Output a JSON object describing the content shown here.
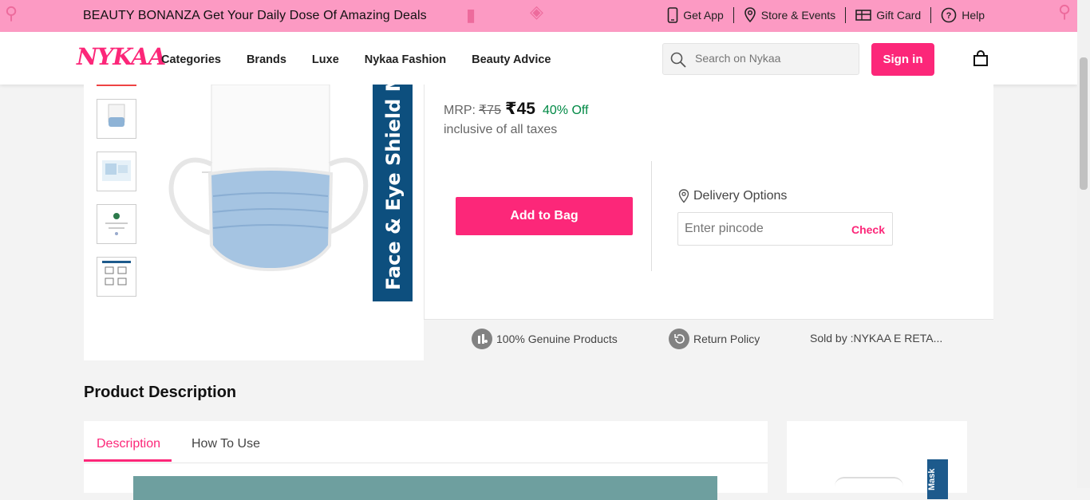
{
  "promo": {
    "text": "BEAUTY BONANZA Get Your Daily Dose Of Amazing Deals",
    "links": [
      {
        "label": "Get App",
        "icon": "phone-icon"
      },
      {
        "label": "Store & Events",
        "icon": "location-pin-icon"
      },
      {
        "label": "Gift Card",
        "icon": "gift-card-icon"
      },
      {
        "label": "Help",
        "icon": "help-icon"
      }
    ]
  },
  "header": {
    "logo": "NYKAA",
    "nav": [
      "Categories",
      "Brands",
      "Luxe",
      "Nykaa Fashion",
      "Beauty Advice"
    ],
    "search_placeholder": "Search on Nykaa",
    "signin_label": "Sign in"
  },
  "product": {
    "image_text": "Face & Eye Shield Ma",
    "mrp_label": "MRP:",
    "mrp": "₹75",
    "price": "₹45",
    "discount": "40% Off",
    "tax_note": "inclusive of all taxes",
    "add_to_bag": "Add to Bag",
    "delivery_title": "Delivery Options",
    "pincode_placeholder": "Enter pincode",
    "check_label": "Check"
  },
  "trust": {
    "genuine": "100% Genuine Products",
    "return": "Return Policy",
    "sold_by": "Sold by :NYKAA E RETA..."
  },
  "description": {
    "title": "Product Description",
    "tabs": [
      "Description",
      "How To Use"
    ],
    "side_text": "Mask"
  },
  "colors": {
    "brand": "#fc2779",
    "promo_bg": "#fc9ac3",
    "discount": "#008945"
  }
}
